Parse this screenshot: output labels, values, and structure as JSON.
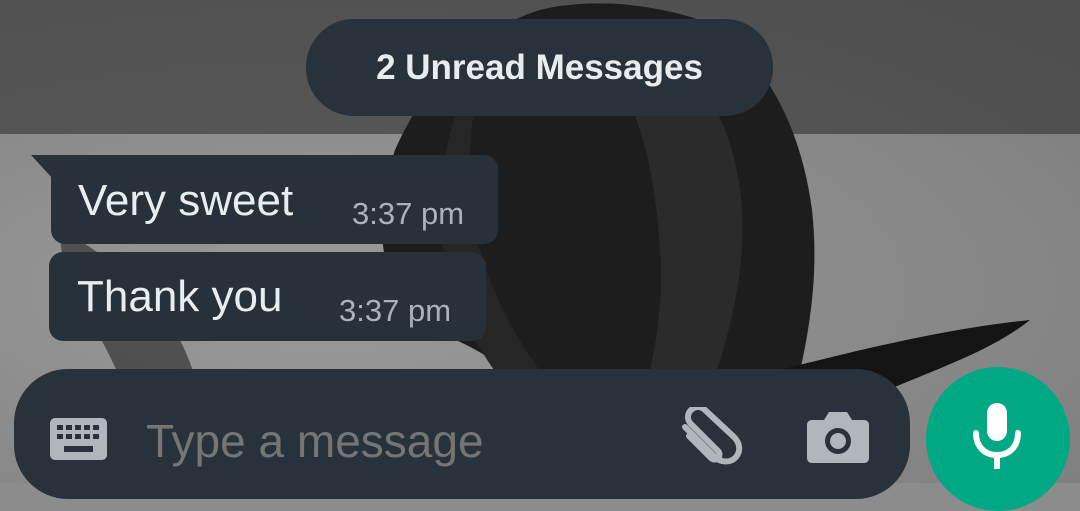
{
  "unread_banner": {
    "label": "2 Unread Messages"
  },
  "messages": [
    {
      "text": "Very sweet",
      "time": "3:37 pm"
    },
    {
      "text": "Thank you",
      "time": "3:37 pm"
    }
  ],
  "composer": {
    "placeholder": "Type a message",
    "icons": [
      "keyboard-icon",
      "paperclip-icon",
      "camera-icon",
      "microphone-icon"
    ]
  },
  "colors": {
    "bubble": "#26313a",
    "accent": "#00a884"
  }
}
